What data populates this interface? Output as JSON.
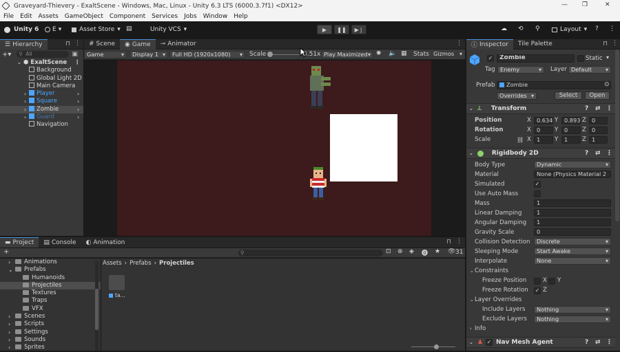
{
  "window": {
    "title": "Graveyard-Thievery - ExaltScene - Windows, Mac, Linux - Unity 6.3 LTS (6000.3.7f1) <DX12>",
    "controls": [
      "—",
      "❐",
      "✕"
    ]
  },
  "menu": [
    "File",
    "Edit",
    "Assets",
    "GameObject",
    "Component",
    "Services",
    "Jobs",
    "Window",
    "Help"
  ],
  "toolbar": {
    "unity": "Unity 6",
    "account": "E",
    "asset_store": "Asset Store",
    "vcs": "Unity VCS",
    "layout": "Layout"
  },
  "hierarchy": {
    "tab": "Hierarchy",
    "search_placeholder": "All",
    "scene": "ExaltScene",
    "items": [
      {
        "label": "Background",
        "color": "#d6d6d6"
      },
      {
        "label": "Global Light 2D",
        "color": "#d6d6d6"
      },
      {
        "label": "Main Camera",
        "color": "#d6d6d6"
      },
      {
        "label": "Player",
        "color": "#4ea6ff"
      },
      {
        "label": "Square",
        "color": "#4ea6ff"
      },
      {
        "label": "Zombie",
        "color": "#d6d6d6"
      },
      {
        "label": "Guard",
        "color": "#4a78a8"
      },
      {
        "label": "Navigation",
        "color": "#d6d6d6"
      }
    ]
  },
  "center_tabs": [
    "Scene",
    "Game",
    "Animator"
  ],
  "game_bar": {
    "mode": "Game",
    "display": "Display 1",
    "resolution": "Full HD (1920x1080)",
    "scale_label": "Scale",
    "scale_value": "0.51x",
    "play_mode": "Play Maximized",
    "stats": "Stats",
    "gizmos": "Gizmos"
  },
  "bottom_tabs": [
    "Project",
    "Console",
    "Animation"
  ],
  "project": {
    "tree": [
      {
        "label": "Animations",
        "indent": 1,
        "arrow": "›"
      },
      {
        "label": "Prefabs",
        "indent": 1,
        "arrow": "⌄"
      },
      {
        "label": "Humanoids",
        "indent": 2,
        "arrow": ""
      },
      {
        "label": "Projectiles",
        "indent": 2,
        "arrow": ""
      },
      {
        "label": "Textures",
        "indent": 2,
        "arrow": ""
      },
      {
        "label": "Traps",
        "indent": 2,
        "arrow": ""
      },
      {
        "label": "VFX",
        "indent": 2,
        "arrow": ""
      },
      {
        "label": "Scenes",
        "indent": 1,
        "arrow": "›"
      },
      {
        "label": "Scripts",
        "indent": 1,
        "arrow": "›"
      },
      {
        "label": "Settings",
        "indent": 1,
        "arrow": "›"
      },
      {
        "label": "Sounds",
        "indent": 1,
        "arrow": "›"
      },
      {
        "label": "Sprites",
        "indent": 1,
        "arrow": "›"
      }
    ],
    "breadcrumb": [
      "Assets",
      "Prefabs",
      "Projectiles"
    ],
    "count": "31",
    "asset_label": "ta..."
  },
  "inspector": {
    "tabs": [
      "Inspector",
      "Tile Palette"
    ],
    "object_name": "Zombie",
    "static_label": "Static",
    "tag_label": "Tag",
    "tag_value": "Enemy",
    "layer_label": "Layer",
    "layer_value": "Default",
    "prefab_label": "Prefab",
    "prefab_value": "Zombie",
    "overrides": "Overrides",
    "select": "Select",
    "open": "Open",
    "transform": {
      "title": "Transform",
      "position_label": "Position",
      "rotation_label": "Rotation",
      "scale_label": "Scale",
      "position": [
        "0.634",
        "0.893",
        "0"
      ],
      "rotation": [
        "0",
        "0",
        "0"
      ],
      "scale": [
        "1",
        "1",
        "1"
      ]
    },
    "rigidbody": {
      "title": "Rigidbody 2D",
      "rows": [
        {
          "label": "Body Type",
          "value": "Dynamic",
          "kind": "drop"
        },
        {
          "label": "Material",
          "value": "None (Physics Material 2",
          "kind": "field"
        },
        {
          "label": "Simulated",
          "value": "✓",
          "kind": "check"
        },
        {
          "label": "Use Auto Mass",
          "value": "",
          "kind": "check"
        },
        {
          "label": "Mass",
          "value": "1",
          "kind": "field"
        },
        {
          "label": "Linear Damping",
          "value": "1",
          "kind": "field"
        },
        {
          "label": "Angular Damping",
          "value": "1",
          "kind": "field"
        },
        {
          "label": "Gravity Scale",
          "value": "0",
          "kind": "field"
        },
        {
          "label": "Collision Detection",
          "value": "Discrete",
          "kind": "drop"
        },
        {
          "label": "Sleeping Mode",
          "value": "Start Awake",
          "kind": "drop"
        },
        {
          "label": "Interpolate",
          "value": "None",
          "kind": "drop"
        }
      ],
      "constraints": "Constraints",
      "freeze_position": "Freeze Position",
      "freeze_rotation": "Freeze Rotation",
      "x": "X",
      "y": "Y",
      "z": "Z",
      "layer_overrides": "Layer Overrides",
      "include_layers": "Include Layers",
      "include_value": "Nothing",
      "exclude_layers": "Exclude Layers",
      "exclude_value": "Nothing",
      "info": "Info"
    },
    "nav_mesh_agent": "Nav Mesh Agent"
  }
}
